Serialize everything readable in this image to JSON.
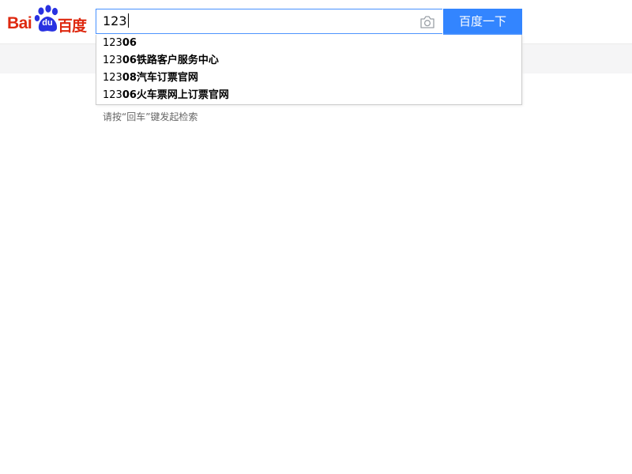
{
  "logo": {
    "latin": "Bai",
    "paw_text": "du",
    "chinese": "百度"
  },
  "search": {
    "value": "123",
    "button_label": "百度一下"
  },
  "icons": {
    "camera": "camera-icon",
    "logo_paw": "paw-icon"
  },
  "colors": {
    "brand_red": "#de2910",
    "brand_blue": "#2932e1",
    "button_blue": "#3385ff",
    "input_border": "#4791ff"
  },
  "suggestions": [
    {
      "prefix": "123",
      "rest": "06"
    },
    {
      "prefix": "123",
      "rest": "06铁路客户服务中心"
    },
    {
      "prefix": "123",
      "rest": "08汽车订票官网"
    },
    {
      "prefix": "123",
      "rest": "06火车票网上订票官网"
    }
  ],
  "hint": "请按“回车”键发起检索"
}
